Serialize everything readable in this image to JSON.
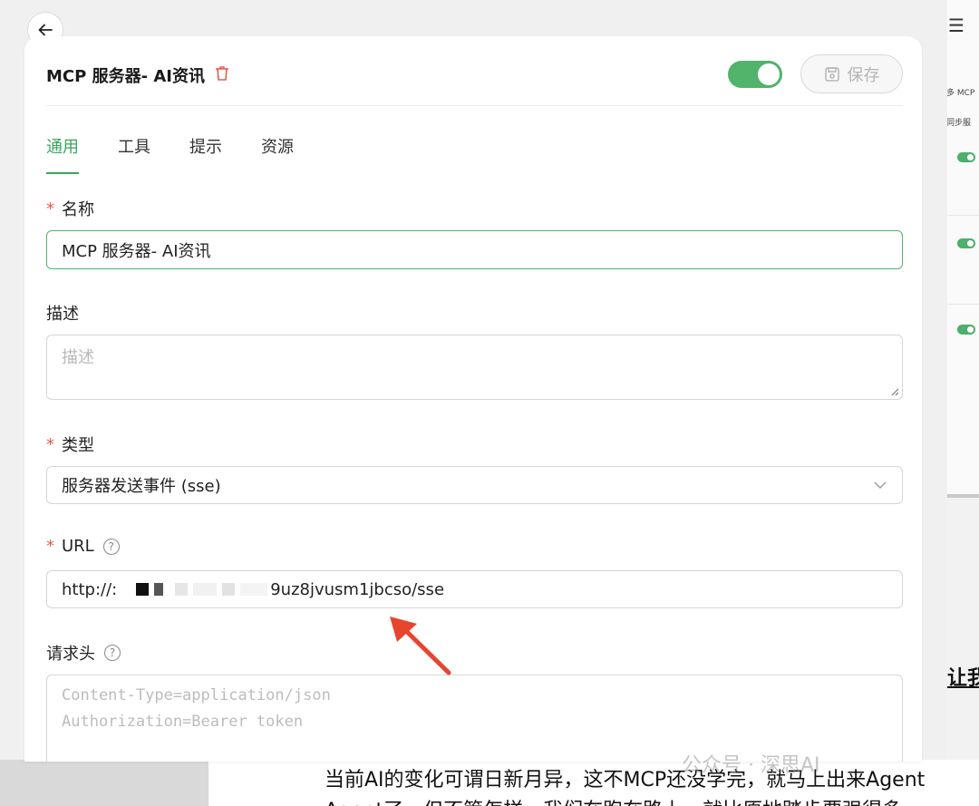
{
  "header": {
    "title": "MCP 服务器- AI资讯",
    "save_label": "保存",
    "enabled": true
  },
  "tabs": [
    {
      "label": "通用",
      "active": true
    },
    {
      "label": "工具",
      "active": false
    },
    {
      "label": "提示",
      "active": false
    },
    {
      "label": "资源",
      "active": false
    }
  ],
  "form": {
    "name": {
      "label": "名称",
      "required": "*",
      "value": "MCP 服务器- AI资讯"
    },
    "description": {
      "label": "描述",
      "placeholder": "描述"
    },
    "type": {
      "label": "类型",
      "required": "*",
      "value": "服务器发送事件 (sse)"
    },
    "url": {
      "label": "URL",
      "required": "*",
      "value_prefix": "http://:",
      "value_suffix": "9uz8jvusm1jbcso/sse"
    },
    "headers": {
      "label": "请求头",
      "placeholder_line1": "Content-Type=application/json",
      "placeholder_line2": "Authorization=Bearer token"
    }
  },
  "background": {
    "tag1": "多 MCP",
    "tag2": "同步服",
    "article_line1": "当前AI的变化可谓日新月异，这不MCP还没学完，就马上出来Agent",
    "article_line2": "Agent了，但不管怎样，我们在跑在路上，就比原地踏步要强得多",
    "article_side": "让我",
    "watermark": "公众号 · 深思AI"
  },
  "colors": {
    "accent": "#52b36b",
    "danger": "#e35b4d",
    "annotation_arrow": "#e8452f"
  }
}
